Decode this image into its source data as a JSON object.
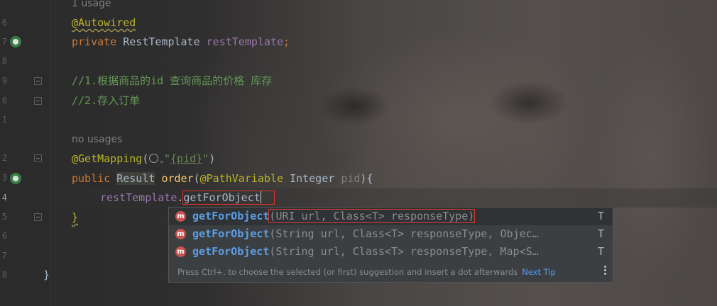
{
  "gutter": {
    "line_numbers": [
      "6",
      "7",
      "8",
      "9",
      "0",
      "1",
      "2",
      "3",
      "4",
      "5",
      "6",
      "7",
      "8"
    ]
  },
  "editor": {
    "usages_top": "1 usage",
    "autowired": "@Autowired",
    "field_kw": "private",
    "field_type": "RestTemplate",
    "field_name": "restTemplate",
    "field_semicolon": ";",
    "comment1": "//1.根据商品的id 查询商品的价格 库存",
    "comment2": "//2.存入订单",
    "usages_mid": "no usages",
    "getmapping": "@GetMapping",
    "paren_open": "(",
    "chevron": "⌄",
    "str_quote": "\"",
    "str_value": "{pid}",
    "paren_close": ")",
    "public_kw": "public",
    "result_type": "Result",
    "method_name": "order",
    "param_open": "(",
    "pathvariable": "@PathVariable",
    "integer_type": "Integer",
    "param_name": "pid",
    "param_close": "){",
    "call_target": "restTemplate",
    "dot": ".",
    "typed": "getForObject",
    "close_brace_inner": "}",
    "close_brace_outer": "}"
  },
  "completion": {
    "items": [
      {
        "name": "getForObject",
        "signature": "(URI url, Class<T> responseType)",
        "type": "T"
      },
      {
        "name": "getForObject",
        "signature": "(String url, Class<T> responseType, Objec…",
        "type": "T"
      },
      {
        "name": "getForObject",
        "signature": "(String url, Class<T> responseType, Map<S…",
        "type": "T"
      }
    ],
    "badge": "m",
    "footer_text": "Press Ctrl+. to choose the selected (or first) suggestion and insert a dot afterwards",
    "next_tip": "Next Tip"
  }
}
